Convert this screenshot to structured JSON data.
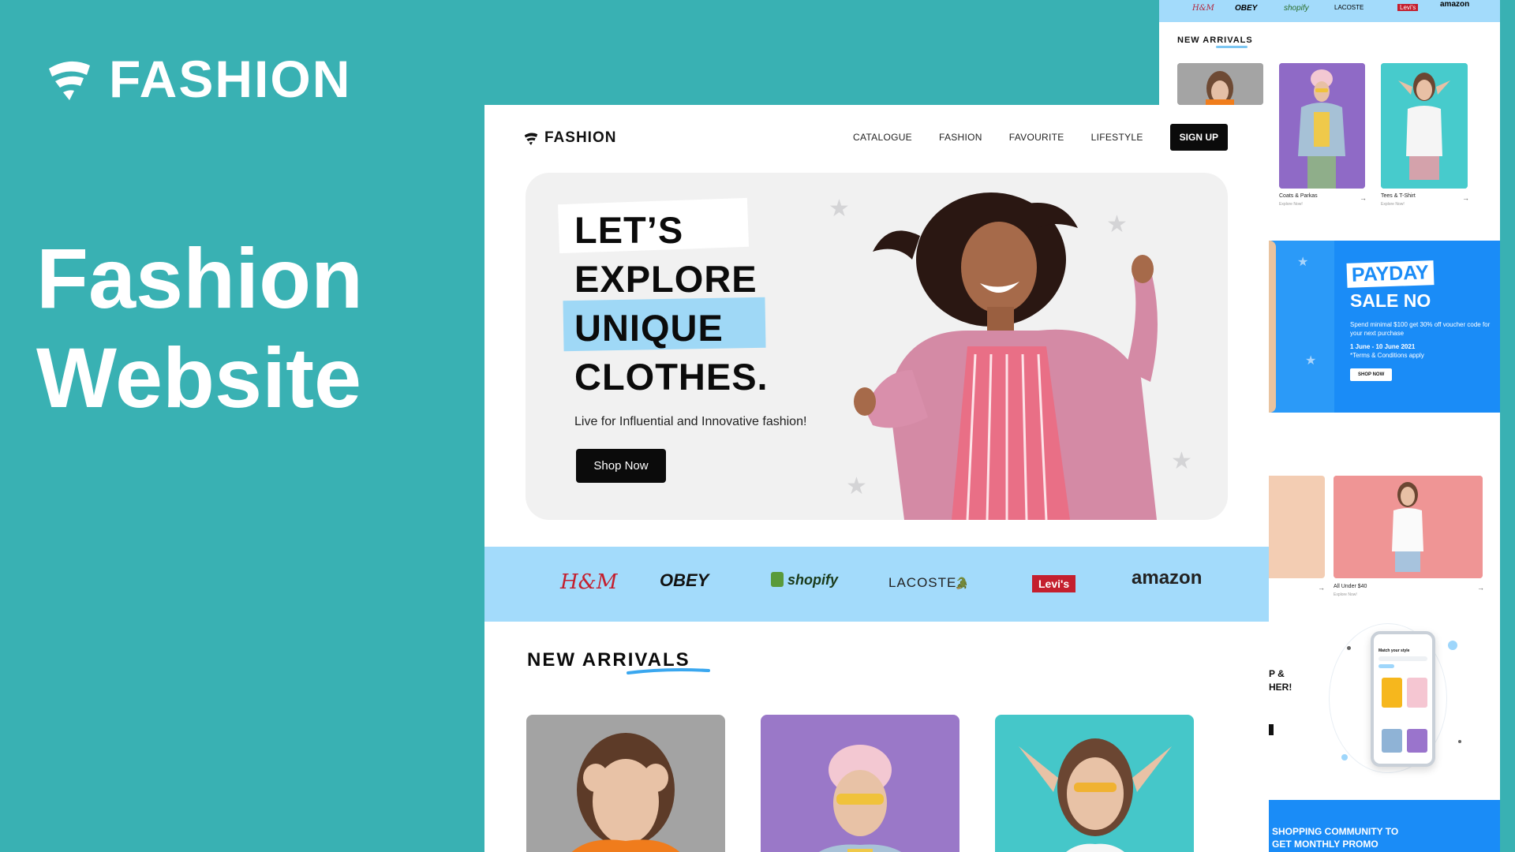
{
  "brand": {
    "name": "FASHION",
    "colors": {
      "teal": "#39b1b3",
      "black": "#0b0b0b",
      "light_blue": "#a3dbfb",
      "promo_blue": "#1a8cf7"
    }
  },
  "promo": {
    "title_line1": "Fashion",
    "title_line2": "Website"
  },
  "nav": {
    "logo": "FASHION",
    "links": [
      "CATALOGUE",
      "FASHION",
      "FAVOURITE",
      "LIFESTYLE"
    ],
    "signup": "SIGN UP"
  },
  "hero": {
    "line1": "LET’S",
    "line2": "EXPLORE",
    "line3": "UNIQUE",
    "line4": "CLOTHES.",
    "subtitle": "Live for Influential and Innovative fashion!",
    "button": "Shop Now"
  },
  "brands": [
    "H&M",
    "OBEY",
    "shopify",
    "LACOSTE",
    "Levi's",
    "amazon"
  ],
  "new_arrivals": {
    "title": "NEW ARRIVALS"
  },
  "side": {
    "brands": [
      "H&M",
      "OBEY",
      "shopify",
      "LACOSTE",
      "Levi's",
      "amazon"
    ],
    "new_arrivals": "NEW ARRIVALS",
    "cards": [
      {
        "caption": "Coats & Parkas",
        "sub": "Explore Now!"
      },
      {
        "caption": "Tees & T-Shirt",
        "sub": "Explore Now!"
      },
      {
        "caption": "All Under $40",
        "sub": "Explore Now!"
      }
    ],
    "payday": {
      "title": "PAYDAY",
      "subtitle": "SALE NO",
      "text": "Spend minimal $100 get 30% off voucher code for your next purchase",
      "date": "1 June - 10 June 2021",
      "terms": "*Terms & Conditions apply",
      "button": "SHOP NOW"
    },
    "app_text": "P &",
    "app_text2": "HER!",
    "phone_label": "Match your style",
    "community": "SHOPPING COMMUNITY TO",
    "community2": "GET MONTHLY PROMO"
  }
}
